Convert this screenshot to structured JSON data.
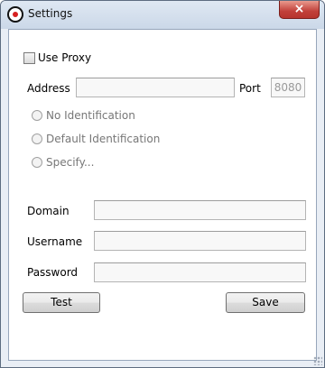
{
  "window": {
    "title": "Settings",
    "close_label": "×"
  },
  "proxy": {
    "use_proxy_label": "Use Proxy",
    "use_proxy_checked": false,
    "address_label": "Address",
    "address_value": "",
    "port_label": "Port",
    "port_value": "8080"
  },
  "identification": {
    "options": [
      {
        "label": "No Identification",
        "selected": false
      },
      {
        "label": "Default Identification",
        "selected": false
      },
      {
        "label": "Specify...",
        "selected": false
      }
    ]
  },
  "credentials": {
    "domain_label": "Domain",
    "domain_value": "",
    "username_label": "Username",
    "username_value": "",
    "password_label": "Password",
    "password_value": ""
  },
  "buttons": {
    "test_label": "Test",
    "save_label": "Save"
  },
  "colors": {
    "window_frame": "#e9eef5",
    "close_button": "#c1403a",
    "disabled_text": "#777777"
  }
}
